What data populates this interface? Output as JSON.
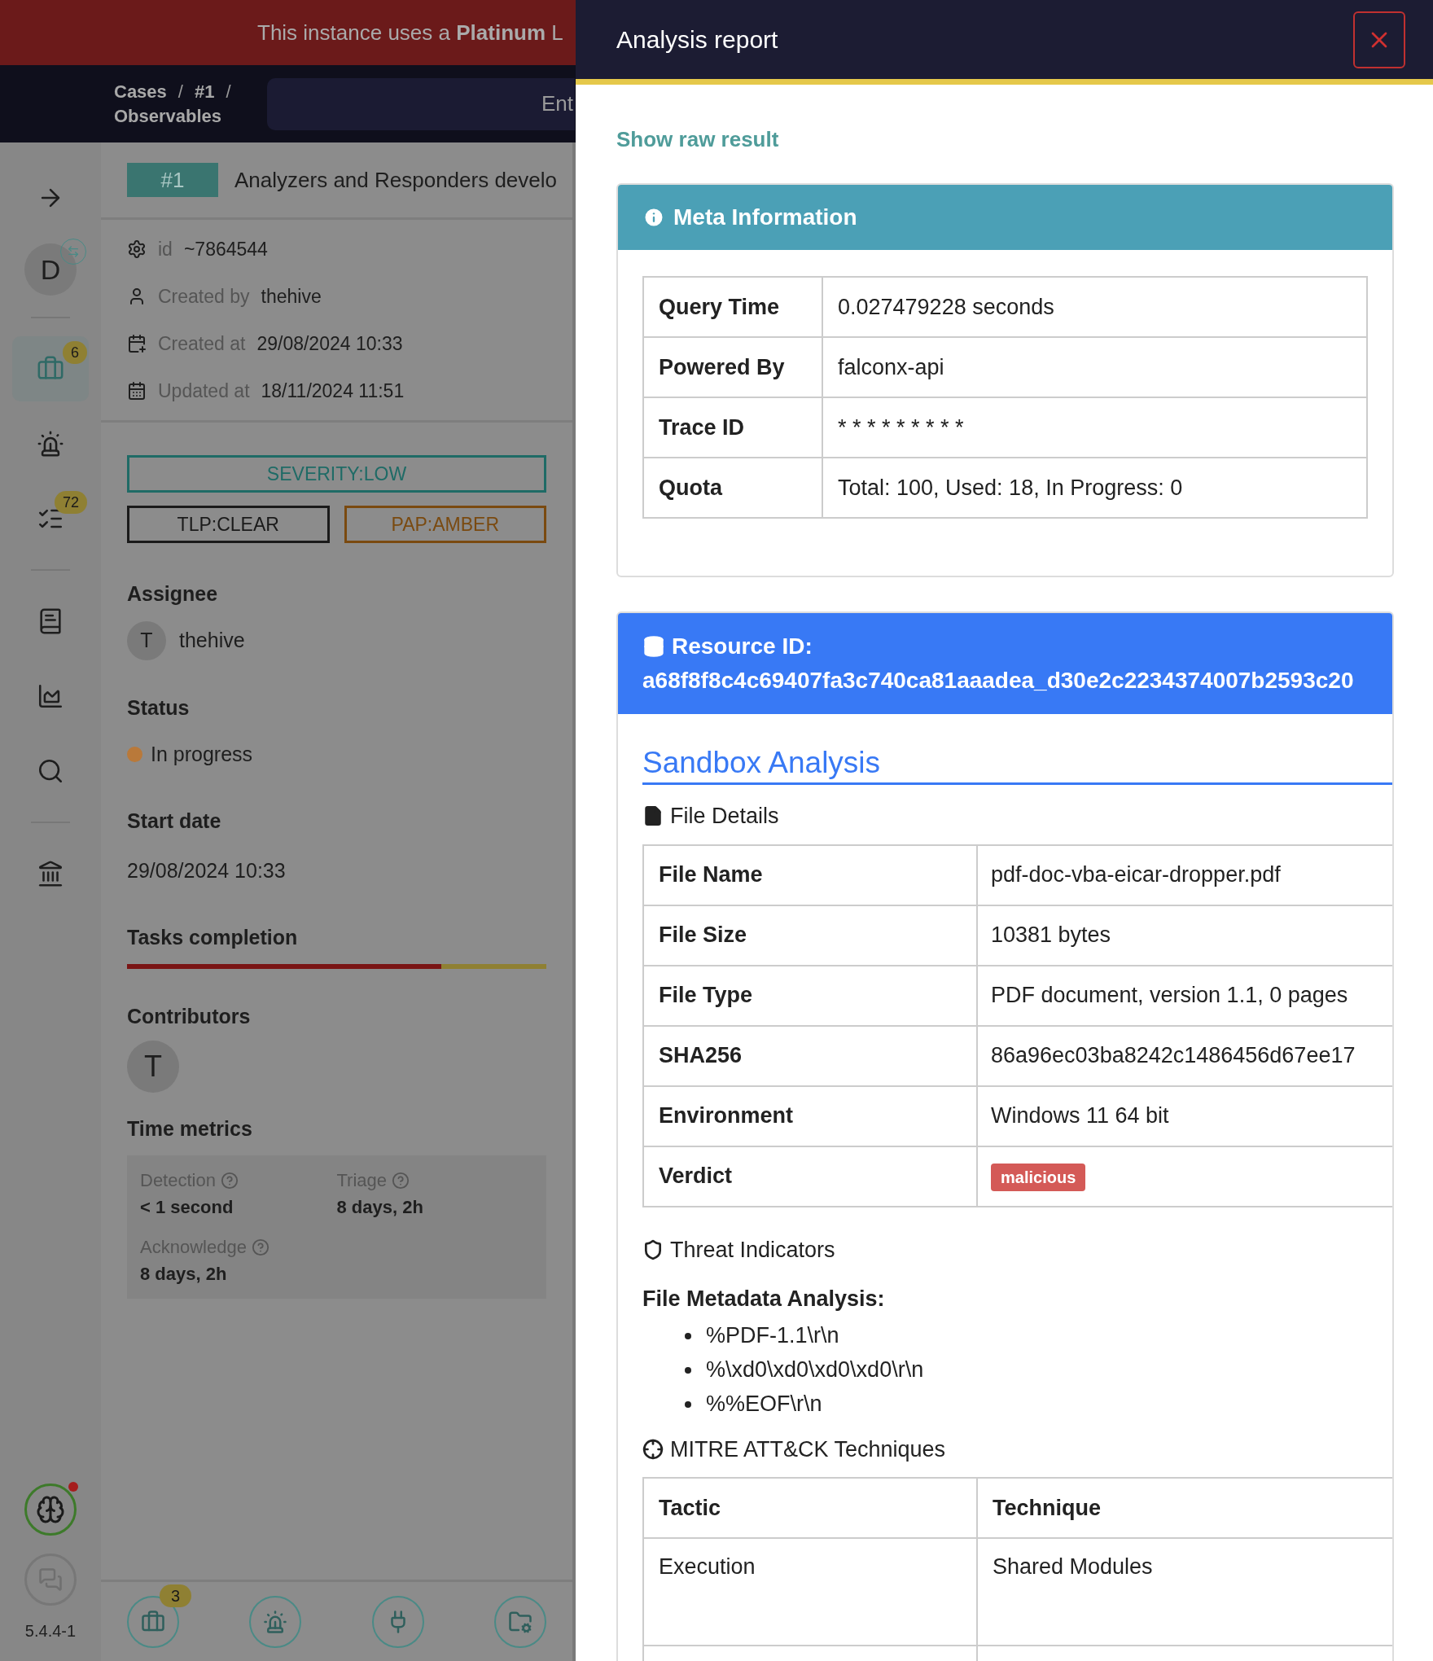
{
  "banner": {
    "text": "This instance uses a **Platinum** L"
  },
  "breadcrumb": [
    {
      "kind": "link",
      "text": "Cases"
    },
    {
      "kind": "separator",
      "text": "/"
    },
    {
      "kind": "link",
      "text": "#1"
    },
    {
      "kind": "separator",
      "text": "/"
    },
    {
      "kind": "link",
      "text": "Observables"
    }
  ],
  "search": {
    "placeholder": "Ent"
  },
  "sidebar": {
    "items": [
      {
        "kind": "expand",
        "selected": false
      },
      {
        "kind": "avatar",
        "initial": "D",
        "selected": false
      },
      {
        "kind": "divider"
      },
      {
        "kind": "cases",
        "badge": "6",
        "selected": true
      },
      {
        "kind": "alerts",
        "selected": false
      },
      {
        "kind": "tasks",
        "badge": "72",
        "selected": false
      },
      {
        "kind": "divider"
      },
      {
        "kind": "knowledge",
        "selected": false
      },
      {
        "kind": "dashboards",
        "selected": false
      },
      {
        "kind": "search",
        "selected": false
      },
      {
        "kind": "divider"
      },
      {
        "kind": "organisation",
        "selected": false
      }
    ],
    "assistant": {
      "notification": true
    },
    "version": "5.4.4-1"
  },
  "case": {
    "number": "#1",
    "title": "Analyzers and Responders develo",
    "details": [
      {
        "kind": "id",
        "label": "id",
        "value": "~7864544"
      },
      {
        "kind": "user",
        "label": "Created by",
        "value": "thehive"
      },
      {
        "kind": "created",
        "label": "Created at",
        "value": "29/08/2024 10:33"
      },
      {
        "kind": "updated",
        "label": "Updated at",
        "value": "18/11/2024 11:51"
      }
    ],
    "tags": [
      {
        "text": "SEVERITY:LOW",
        "color": "#1f6b66",
        "wide": true
      },
      {
        "text": "TLP:CLEAR",
        "color": "#1a1a1a",
        "wide": false
      },
      {
        "text": "PAP:AMBER",
        "color": "#7a4a10",
        "wide": false
      }
    ],
    "assignee": {
      "label": "Assignee",
      "initial": "T",
      "name": "thehive"
    },
    "status": {
      "label": "Status",
      "value": "In progress",
      "color": "#b9793a"
    },
    "start_date": {
      "label": "Start date",
      "value": "29/08/2024 10:33"
    },
    "tasks_completion": {
      "label": "Tasks completion",
      "level": 0.75
    },
    "contributors": {
      "label": "Contributors",
      "initials": [
        "T"
      ]
    },
    "time_metrics": {
      "label": "Time metrics",
      "items": [
        {
          "label": "Detection",
          "value": "< 1 second"
        },
        {
          "label": "Triage",
          "value": "8 days, 2h"
        },
        {
          "label": "Acknowledge",
          "value": "8 days, 2h"
        }
      ]
    }
  },
  "bottom_nav": [
    {
      "kind": "cases",
      "badge": "3"
    },
    {
      "kind": "alerts"
    },
    {
      "kind": "integrations"
    },
    {
      "kind": "files"
    }
  ],
  "drawer": {
    "title": "Analysis report",
    "raw_link": "Show raw result",
    "meta": {
      "title": "Meta Information",
      "rows": [
        {
          "label": "Query Time",
          "value": "0.027479228 seconds"
        },
        {
          "label": "Powered By",
          "value": "falconx-api"
        },
        {
          "label": "Trace ID",
          "value": "* * * * * * * * *"
        },
        {
          "label": "Quota",
          "value": "Total: 100, Used: 18, In Progress: 0"
        }
      ]
    },
    "resource": {
      "label": "Resource ID:",
      "value": "a68f8f8c4c69407fa3c740ca81aaadea_d30e2c2234374007b2593c20"
    },
    "sandbox": {
      "title": "Sandbox Analysis",
      "file_details": {
        "title": "File Details",
        "rows": [
          {
            "label": "File Name",
            "value": "pdf-doc-vba-eicar-dropper.pdf",
            "kind": "text"
          },
          {
            "label": "File Size",
            "value": "10381 bytes",
            "kind": "text"
          },
          {
            "label": "File Type",
            "value": "PDF document, version 1.1, 0 pages",
            "kind": "text"
          },
          {
            "label": "SHA256",
            "value": "86a96ec03ba8242c1486456d67ee17",
            "kind": "text"
          },
          {
            "label": "Environment",
            "value": "Windows 11 64 bit",
            "kind": "text"
          },
          {
            "label": "Verdict",
            "value": "malicious",
            "kind": "badge"
          }
        ]
      },
      "threat_indicators": {
        "title": "Threat Indicators",
        "subtitle": "File Metadata Analysis:",
        "items": [
          "%PDF-1.1\\r\\n",
          "%\\xd0\\xd0\\xd0\\xd0\\r\\n",
          "%%EOF\\r\\n"
        ]
      },
      "mitre": {
        "title": "MITRE ATT&CK Techniques",
        "columns": [
          "Tactic",
          "Technique"
        ],
        "rows": [
          [
            "Execution",
            "Shared Modules"
          ]
        ]
      }
    }
  }
}
